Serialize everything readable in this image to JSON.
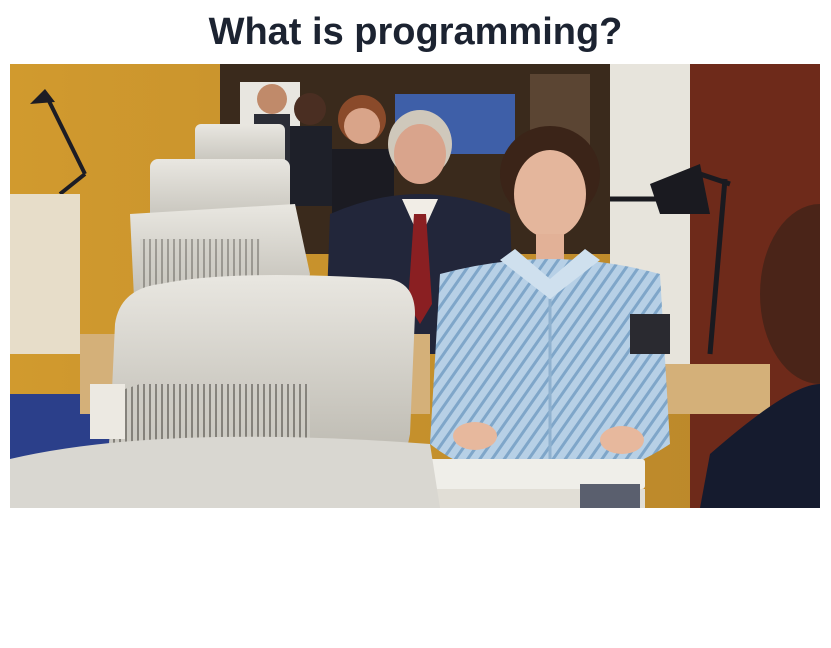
{
  "slide": {
    "title": "What is programming?"
  },
  "image": {
    "subject": "office-workers-typing-on-crt-computers"
  },
  "colors": {
    "title_text": "#1c2331",
    "background": "#ffffff",
    "shirt_stripe": "#a9c6de",
    "wall": "#c9952f"
  }
}
